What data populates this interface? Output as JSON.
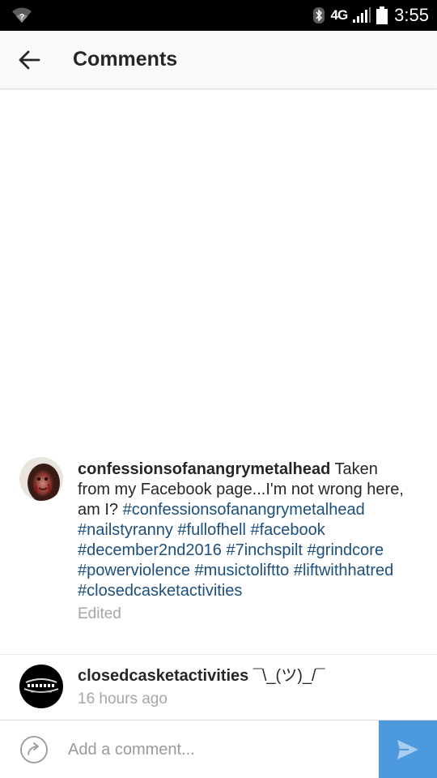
{
  "status_bar": {
    "network": "4G",
    "time": "3:55",
    "icons": [
      "wifi-icon",
      "bluetooth-icon",
      "signal-icon",
      "battery-icon"
    ]
  },
  "header": {
    "title": "Comments",
    "back_icon": "arrow-left-icon"
  },
  "comments": [
    {
      "username": "confessionsofanangrymetalhead",
      "text": "Taken from my Facebook page...I'm not wrong here, am I?",
      "hashtags": [
        "#confessionsofanangrymetalhead",
        "#nailstyranny",
        "#fullofhell",
        "#facebook",
        "#december2nd2016",
        "#7inchspilt",
        "#grindcore",
        "#powerviolence",
        "#musictoliftto",
        "#liftwithhatred",
        "#closedcasketactivities"
      ],
      "meta": "Edited"
    },
    {
      "username": "closedcasketactivities",
      "text": "¯\\_(ツ)_/¯",
      "meta": "16 hours ago"
    }
  ],
  "composer": {
    "placeholder": "Add a comment...",
    "send_icon": "send-icon"
  },
  "colors": {
    "hashtag": "#1c4f7c",
    "send_button": "#4d99dd",
    "meta_text": "#a6a6a6"
  }
}
